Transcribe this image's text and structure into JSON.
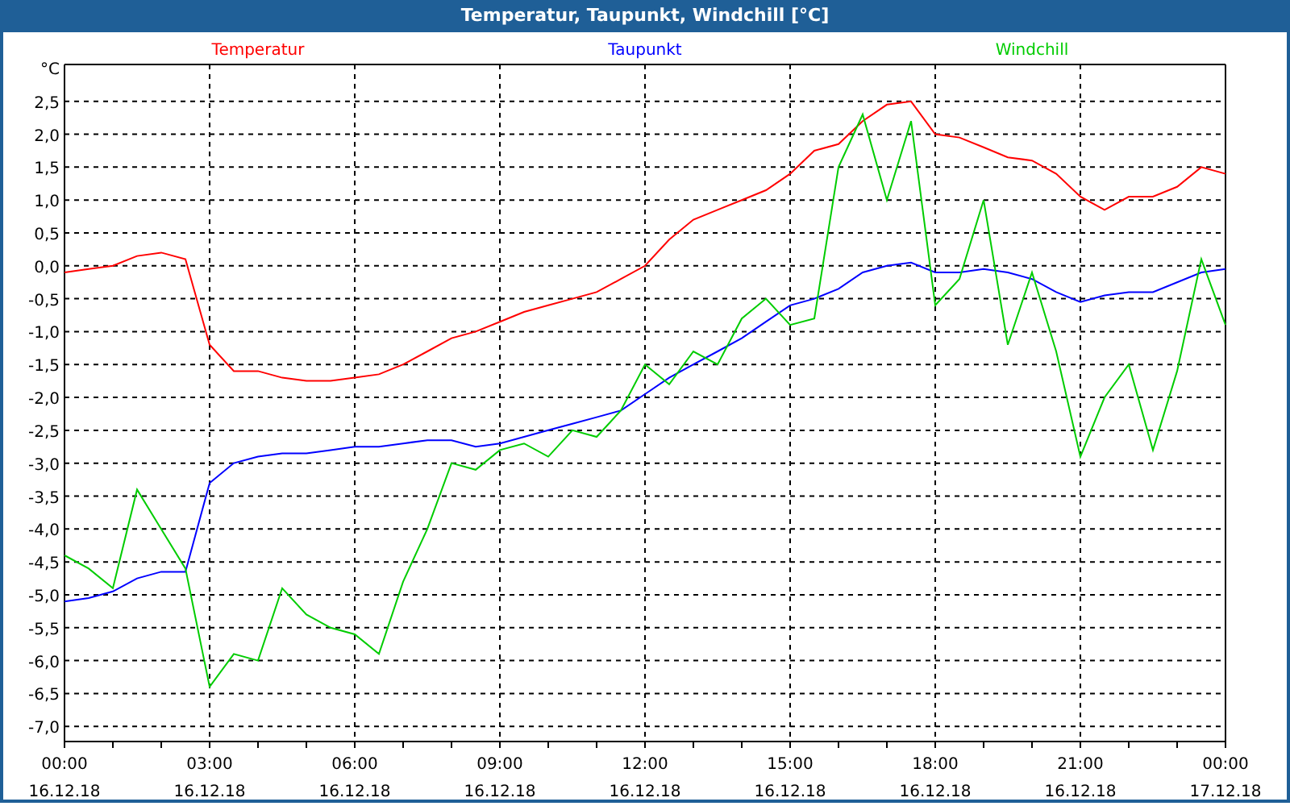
{
  "window": {
    "title": "Temperatur, Taupunkt, Windchill [°C]"
  },
  "chart": {
    "chart_data": {
      "type": "line",
      "ylabel": "°C",
      "categories": [
        "00:00\n16.12.18",
        null,
        null,
        null,
        null,
        null,
        "03:00\n16.12.18",
        null,
        null,
        null,
        null,
        null,
        "06:00\n16.12.18",
        null,
        null,
        null,
        null,
        null,
        "09:00\n16.12.18",
        null,
        null,
        null,
        null,
        null,
        "12:00\n16.12.18",
        null,
        null,
        null,
        null,
        null,
        "15:00\n16.12.18",
        null,
        null,
        null,
        null,
        null,
        "18:00\n16.12.18",
        null,
        null,
        null,
        null,
        null,
        "21:00\n16.12.18",
        null,
        null,
        null,
        null,
        null,
        "00:00\n17.12.18"
      ],
      "series": [
        {
          "name": "Temperatur",
          "color": "#ff0000",
          "values": [
            -0.1,
            -0.05,
            0.0,
            0.15,
            0.2,
            0.1,
            -1.2,
            -1.6,
            -1.6,
            -1.7,
            -1.75,
            -1.75,
            -1.7,
            -1.65,
            -1.5,
            -1.3,
            -1.1,
            -1.0,
            -0.85,
            -0.7,
            -0.6,
            -0.5,
            -0.4,
            -0.2,
            0.0,
            0.4,
            0.7,
            0.85,
            1.0,
            1.15,
            1.4,
            1.75,
            1.85,
            2.2,
            2.45,
            2.5,
            2.0,
            1.95,
            1.8,
            1.65,
            1.6,
            1.4,
            1.05,
            0.85,
            1.05,
            1.05,
            1.2,
            1.5,
            1.4
          ]
        },
        {
          "name": "Taupunkt",
          "color": "#0000ff",
          "values": [
            -5.1,
            -5.05,
            -4.95,
            -4.75,
            -4.65,
            -4.65,
            -3.3,
            -3.0,
            -2.9,
            -2.85,
            -2.85,
            -2.8,
            -2.75,
            -2.75,
            -2.7,
            -2.65,
            -2.65,
            -2.75,
            -2.7,
            -2.6,
            -2.5,
            -2.4,
            -2.3,
            -2.2,
            -1.95,
            -1.7,
            -1.5,
            -1.3,
            -1.1,
            -0.85,
            -0.6,
            -0.5,
            -0.35,
            -0.1,
            0.0,
            0.05,
            -0.1,
            -0.1,
            -0.05,
            -0.1,
            -0.2,
            -0.4,
            -0.55,
            -0.45,
            -0.4,
            -0.4,
            -0.25,
            -0.1,
            -0.05
          ]
        },
        {
          "name": "Windchill",
          "color": "#00cc00",
          "values": [
            -4.4,
            -4.6,
            -4.9,
            -3.4,
            -4.0,
            -4.6,
            -6.4,
            -5.9,
            -6.0,
            -4.9,
            -5.3,
            -5.5,
            -5.6,
            -5.9,
            -4.8,
            -4.0,
            -3.0,
            -3.1,
            -2.8,
            -2.7,
            -2.9,
            -2.5,
            -2.6,
            -2.2,
            -1.5,
            -1.8,
            -1.3,
            -1.5,
            -0.8,
            -0.5,
            -0.9,
            -0.8,
            1.5,
            2.3,
            1.0,
            2.2,
            -0.6,
            -0.2,
            1.0,
            -1.2,
            -0.1,
            -1.3,
            -2.9,
            -2.0,
            -1.5,
            -2.8,
            -1.6,
            0.1,
            -0.9
          ]
        }
      ],
      "ylim": [
        -7.23,
        3.06
      ],
      "grid": true,
      "yticks": [
        {
          "value": 2.5,
          "label": "2,5"
        },
        {
          "value": 2,
          "label": "2,0"
        },
        {
          "value": 1.5,
          "label": "1,5"
        },
        {
          "value": 1,
          "label": "1,0"
        },
        {
          "value": 0.5,
          "label": "0,5"
        },
        {
          "value": 0,
          "label": "0,0"
        },
        {
          "value": -0.5,
          "label": "-0,5"
        },
        {
          "value": -1,
          "label": "-1,0"
        },
        {
          "value": -1.5,
          "label": "-1,5"
        },
        {
          "value": -2,
          "label": "-2,0"
        },
        {
          "value": -2.5,
          "label": "-2,5"
        },
        {
          "value": -3,
          "label": "-3,0"
        },
        {
          "value": -3.5,
          "label": "-3,5"
        },
        {
          "value": -4,
          "label": "-4,0"
        },
        {
          "value": -4.5,
          "label": "-4,5"
        },
        {
          "value": -5,
          "label": "-5,0"
        },
        {
          "value": -5.5,
          "label": "-5,5"
        },
        {
          "value": -6,
          "label": "-6,0"
        },
        {
          "value": -6.5,
          "label": "-6,5"
        },
        {
          "value": -7,
          "label": "-7,0"
        }
      ]
    }
  }
}
